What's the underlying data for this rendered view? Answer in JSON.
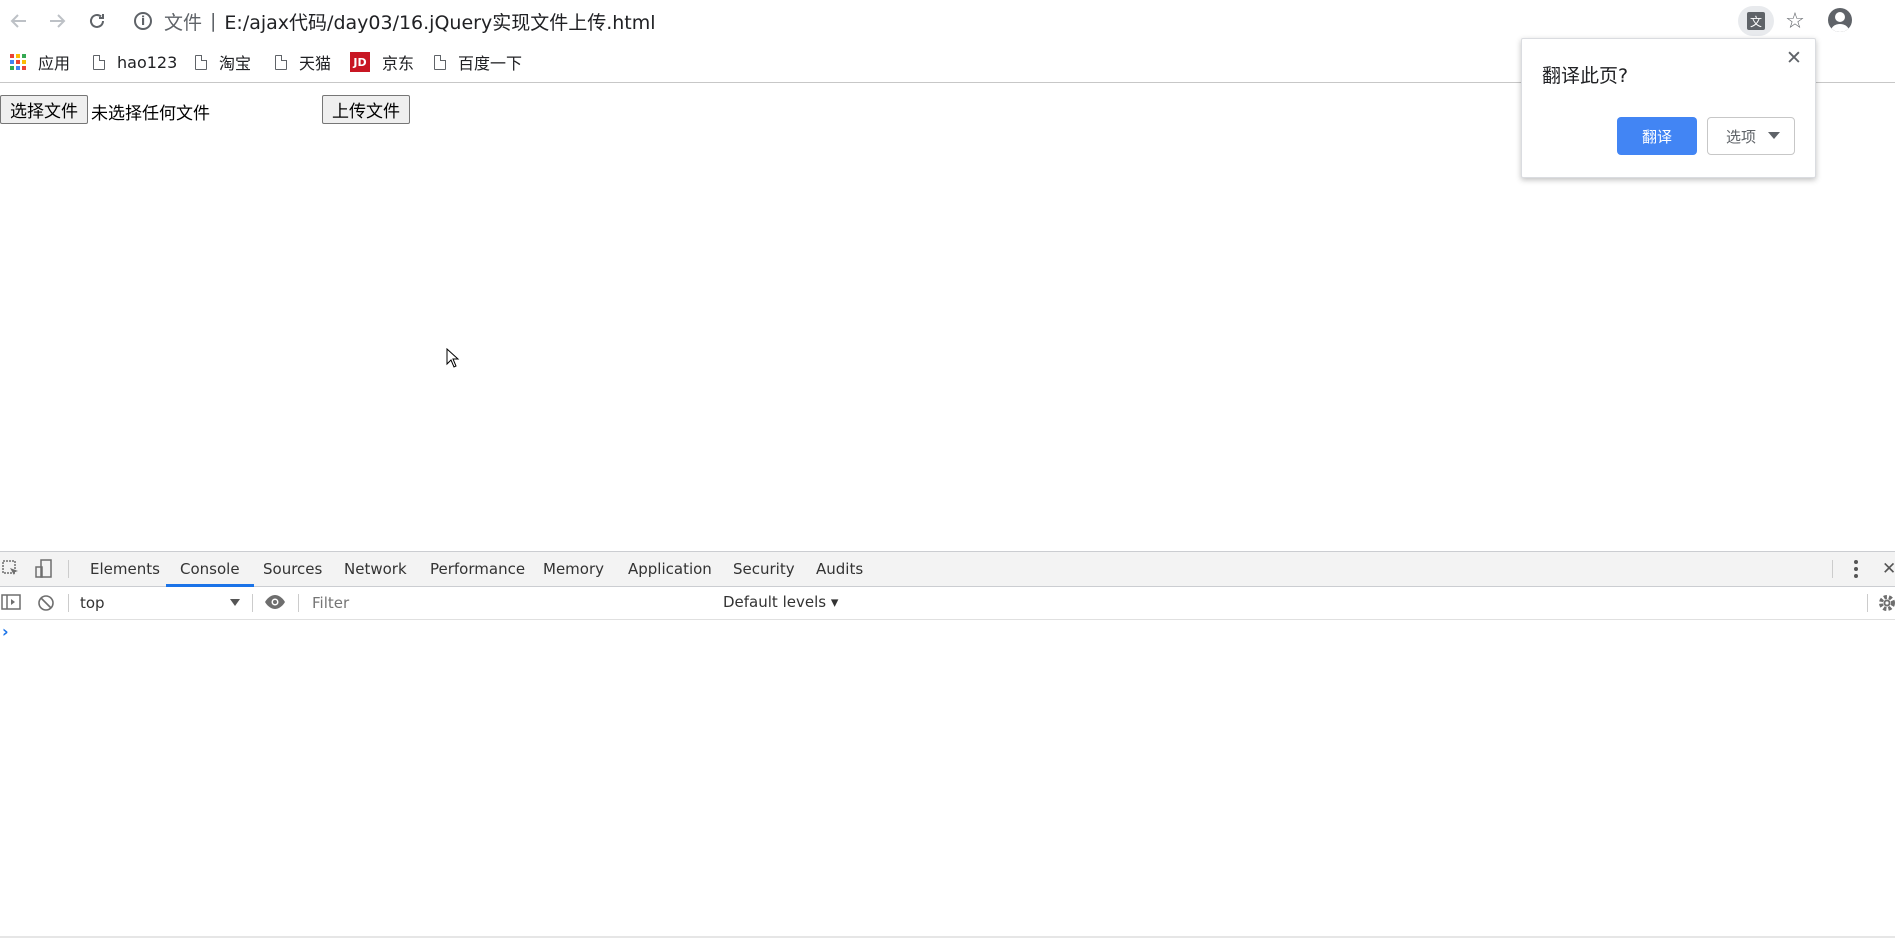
{
  "toolbar": {
    "back_icon": "arrow-left-icon",
    "forward_icon": "arrow-right-icon",
    "reload_icon": "reload-icon",
    "scheme_label": "文件",
    "separator": "|",
    "url": "E:/ajax代码/day03/16.jQuery实现文件上传.html"
  },
  "bookmarks": [
    {
      "label": "应用",
      "icon": "apps-icon"
    },
    {
      "label": "hao123",
      "icon": "page-icon"
    },
    {
      "label": "淘宝",
      "icon": "page-icon"
    },
    {
      "label": "天猫",
      "icon": "page-icon"
    },
    {
      "label": "京东",
      "icon": "jd-icon",
      "icon_text": "JD"
    },
    {
      "label": "百度一下",
      "icon": "page-icon"
    }
  ],
  "page": {
    "choose_file_label": "选择文件",
    "no_file_text": "未选择任何文件",
    "upload_label": "上传文件"
  },
  "translate_popup": {
    "title": "翻译此页?",
    "close": "✕",
    "translate_label": "翻译",
    "options_label": "选项"
  },
  "devtools": {
    "tabs": [
      "Elements",
      "Console",
      "Sources",
      "Network",
      "Performance",
      "Memory",
      "Application",
      "Security",
      "Audits"
    ],
    "active_tab": "Console",
    "context_value": "top",
    "filter_placeholder": "Filter",
    "levels_label": "Default levels ▾",
    "prompt": "›",
    "close": "✕"
  },
  "colors": {
    "accent": "#1a73e8",
    "translate_button": "#4285f4",
    "jd_red": "#c81623"
  }
}
